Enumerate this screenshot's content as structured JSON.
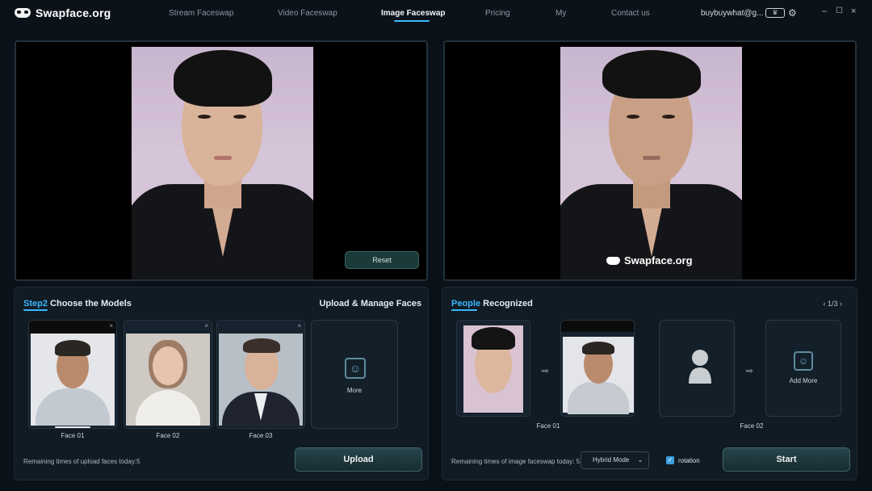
{
  "app": {
    "logo_text": "Swapface.org"
  },
  "nav": {
    "items": [
      {
        "label": "Stream Faceswap",
        "active": false
      },
      {
        "label": "Video Faceswap",
        "active": false
      },
      {
        "label": "Image Faceswap",
        "active": true
      },
      {
        "label": "Pricing",
        "active": false
      },
      {
        "label": "My",
        "active": false
      },
      {
        "label": "Contact us",
        "active": false
      }
    ],
    "user": "buybuywhat@g...",
    "window_controls": {
      "minimize": "–",
      "maximize": "☐",
      "close": "×"
    }
  },
  "preview": {
    "reset_label": "Reset",
    "watermark": "Swapface.org"
  },
  "models": {
    "title_highlight": "Step2",
    "title_rest": " Choose the Models",
    "upload_manage": "Upload & Manage Faces",
    "faces": [
      {
        "label": "Face 01",
        "close": "×"
      },
      {
        "label": "Face 02",
        "close": "×"
      },
      {
        "label": "Face 03",
        "close": "×"
      }
    ],
    "more_label": "More",
    "remaining": "Remaining times of upload faces today:5",
    "upload_button": "Upload"
  },
  "recognized": {
    "title_highlight": "People",
    "title_rest": " Recognized",
    "pager": "1/3",
    "pairs": [
      {
        "label": "Face 01"
      },
      {
        "label": "Face 02"
      }
    ],
    "add_more": "Add More",
    "remaining": "Remaining times of image faceswap today: 5",
    "mode": "Hybrid Mode",
    "rotation_label": "rotation",
    "rotation_checked": true,
    "start_button": "Start"
  },
  "colors": {
    "accent": "#3ab7ff",
    "background": "#0a1118"
  }
}
